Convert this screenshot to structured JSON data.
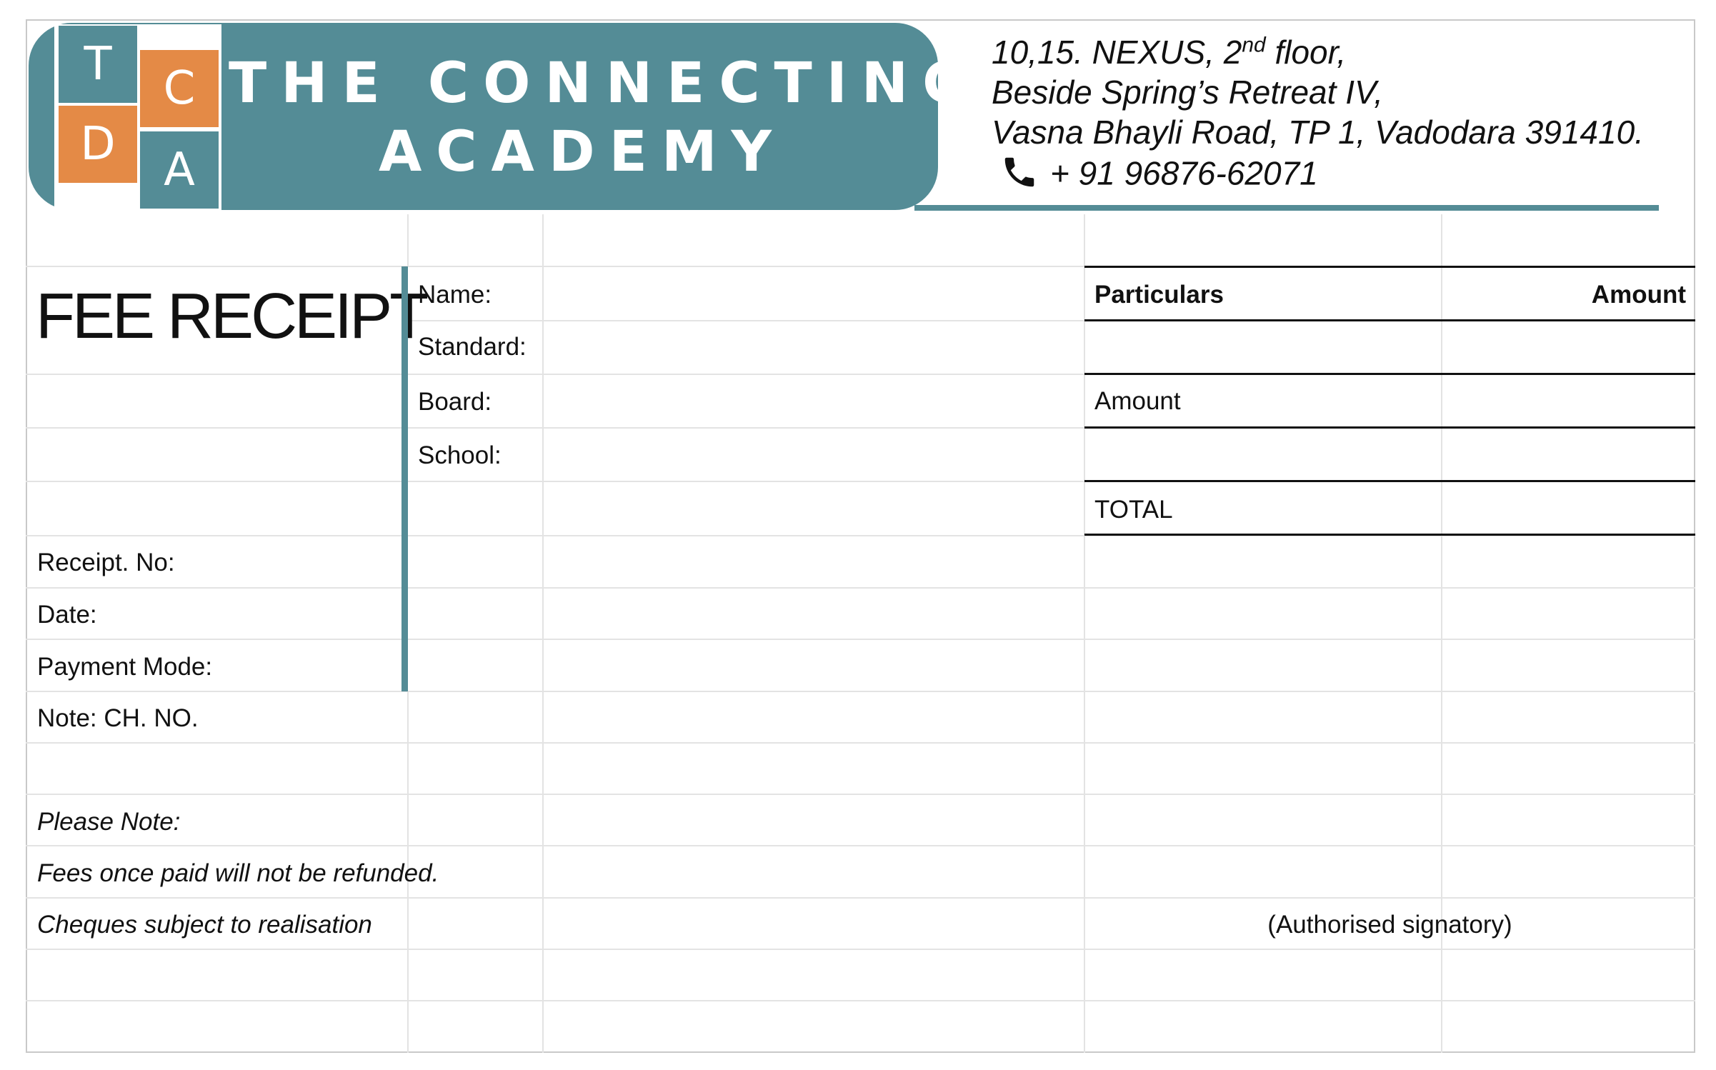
{
  "header": {
    "logo_letters": [
      "T",
      "C",
      "D",
      "A"
    ],
    "brand_line1": "THE CONNECTING DOTS",
    "brand_line2": "ACADEMY",
    "address_line1_pre": "10,15. NEXUS, 2",
    "address_line1_sup": "nd",
    "address_line1_post": " floor,",
    "address_line2": "Beside Spring’s Retreat IV,",
    "address_line3": "Vasna Bhayli Road, TP 1, Vadodara 391410.",
    "phone": "+ 91 96876-62071",
    "phone_icon": "phone-icon",
    "brand_color": "#548c96",
    "accent_color": "#e48a46"
  },
  "receipt": {
    "title": "FEE RECEIPT",
    "student_fields": [
      "Name:",
      "Standard:",
      "Board:",
      "School:"
    ],
    "receipt_fields": [
      "Receipt. No:",
      "Date:",
      "Payment Mode:"
    ],
    "note_cheque": "Note: CH. NO."
  },
  "fees_table": {
    "col_particulars": "Particulars",
    "col_amount": "Amount",
    "row_amount": "Amount",
    "row_total": "TOTAL"
  },
  "footer": {
    "please_note": "Please Note:",
    "no_refund": "Fees once paid will not be refunded.",
    "cheques": "Cheques subject to realisation",
    "signatory": "(Authorised signatory)"
  }
}
